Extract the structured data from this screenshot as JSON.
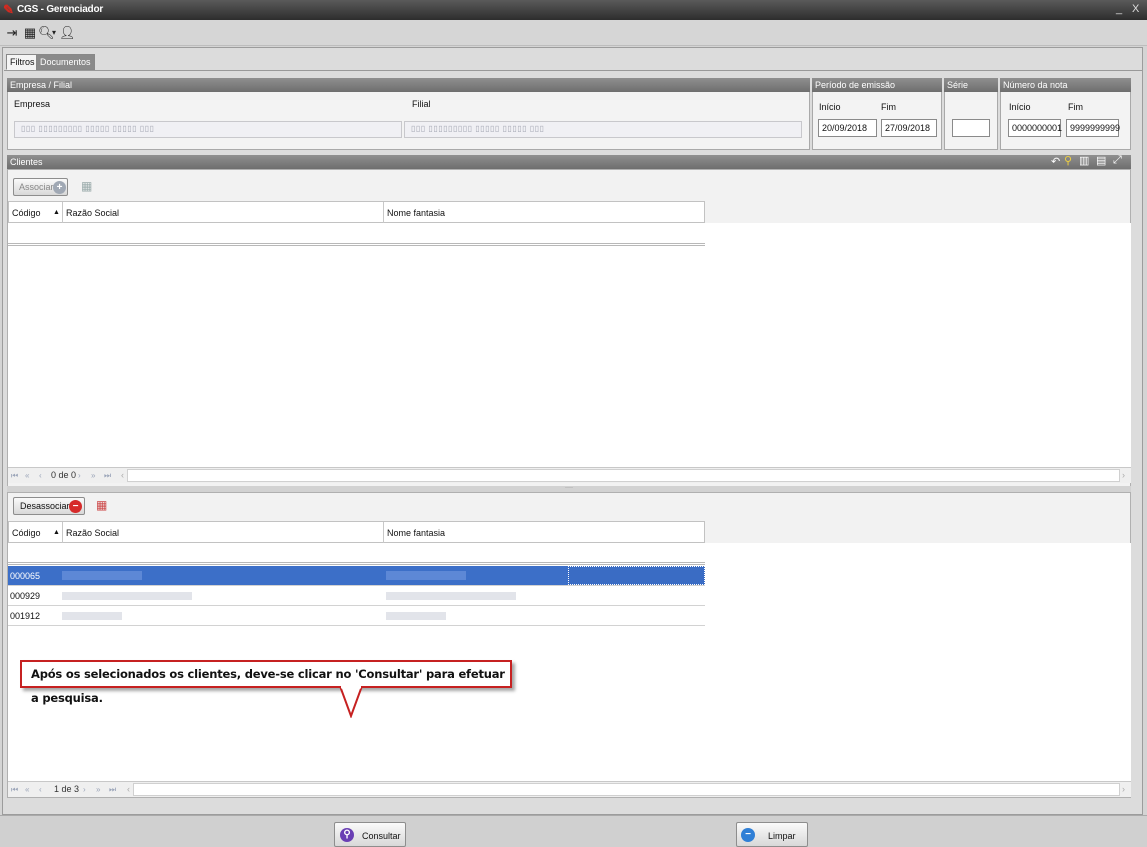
{
  "window": {
    "title": "CGS - Gerenciador",
    "minimize": "_",
    "close": "X"
  },
  "toolbar": {
    "icons": [
      "exit-icon",
      "screen-icon",
      "search-icon",
      "user-icon"
    ]
  },
  "tabs": [
    {
      "label": "Filtros"
    },
    {
      "label": "Documentos"
    }
  ],
  "filters": {
    "empresa_filial_header": "Empresa / Filial",
    "empresa_label": "Empresa",
    "filial_label": "Filial",
    "periodo_header": "Período de emissão",
    "periodo_inicio_label": "Início",
    "periodo_fim_label": "Fim",
    "periodo_inicio_value": "20/09/2018",
    "periodo_fim_value": "27/09/2018",
    "serie_header": "Série",
    "serie_value": "",
    "numero_header": "Número da nota",
    "numero_inicio_label": "Início",
    "numero_fim_label": "Fim",
    "numero_inicio_value": "0000000001",
    "numero_fim_value": "9999999999"
  },
  "clientes": {
    "header": "Clientes",
    "associar_label": "Associar",
    "columns": {
      "codigo": "Código",
      "razao": "Razão Social",
      "fantasia": "Nome fantasia"
    },
    "pager": "0 de 0"
  },
  "selecionados": {
    "desassociar_label": "Desassociar",
    "columns": {
      "codigo": "Código",
      "razao": "Razão Social",
      "fantasia": "Nome fantasia"
    },
    "rows": [
      {
        "codigo": "000065"
      },
      {
        "codigo": "000929"
      },
      {
        "codigo": "001912"
      }
    ],
    "pager": "1 de 3"
  },
  "callout": "Após os selecionados os clientes, deve-se clicar no 'Consultar' para efetuar a pesquisa.",
  "footer": {
    "consultar_label": "Consultar",
    "limpar_label": "Limpar"
  },
  "colors": {
    "selection": "#3c6fc8",
    "callout_border": "#c62121",
    "band": "#7a7a7a"
  }
}
